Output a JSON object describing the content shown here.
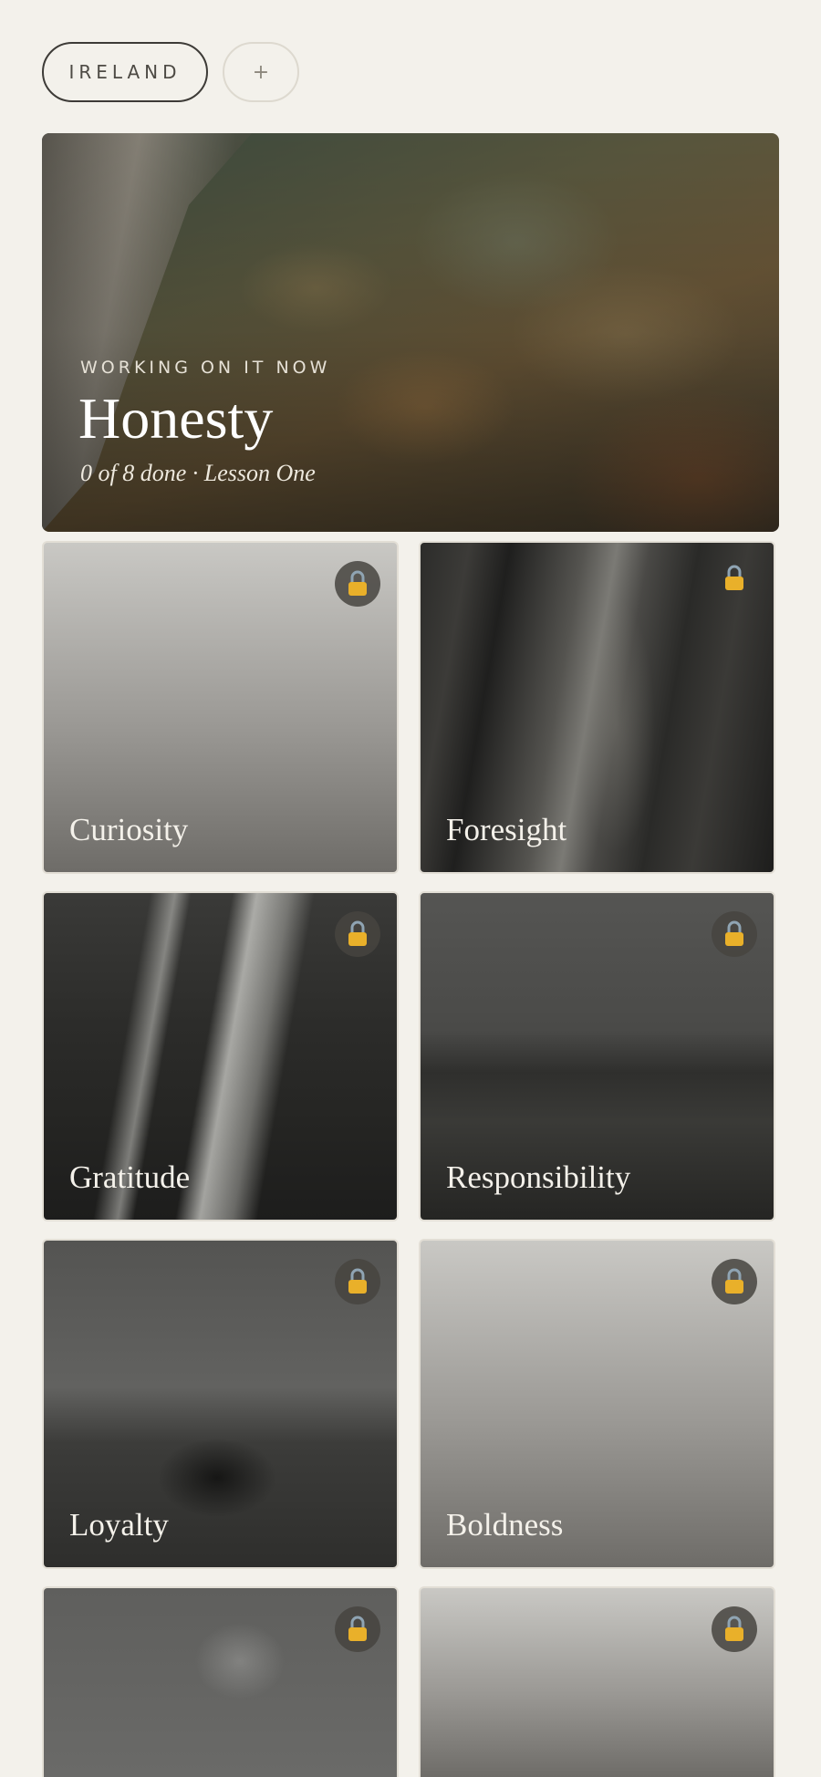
{
  "filters": {
    "country_label": "IRELAND",
    "add_label": "+"
  },
  "hero": {
    "kicker": "WORKING ON IT NOW",
    "title": "Honesty",
    "subtitle": "0 of 8 done · Lesson One"
  },
  "cards": [
    {
      "label": "Curiosity",
      "locked": true
    },
    {
      "label": "Foresight",
      "locked": true
    },
    {
      "label": "Gratitude",
      "locked": true
    },
    {
      "label": "Responsibility",
      "locked": true
    },
    {
      "label": "Loyalty",
      "locked": true
    },
    {
      "label": "Boldness",
      "locked": true
    },
    {
      "label": "",
      "locked": true
    },
    {
      "label": "",
      "locked": true
    }
  ],
  "colors": {
    "background": "#f3f1eb",
    "lock_gold": "#e9b02a",
    "lock_shackle": "#8fa4b3"
  },
  "icons": {
    "lock": "lock-icon"
  }
}
